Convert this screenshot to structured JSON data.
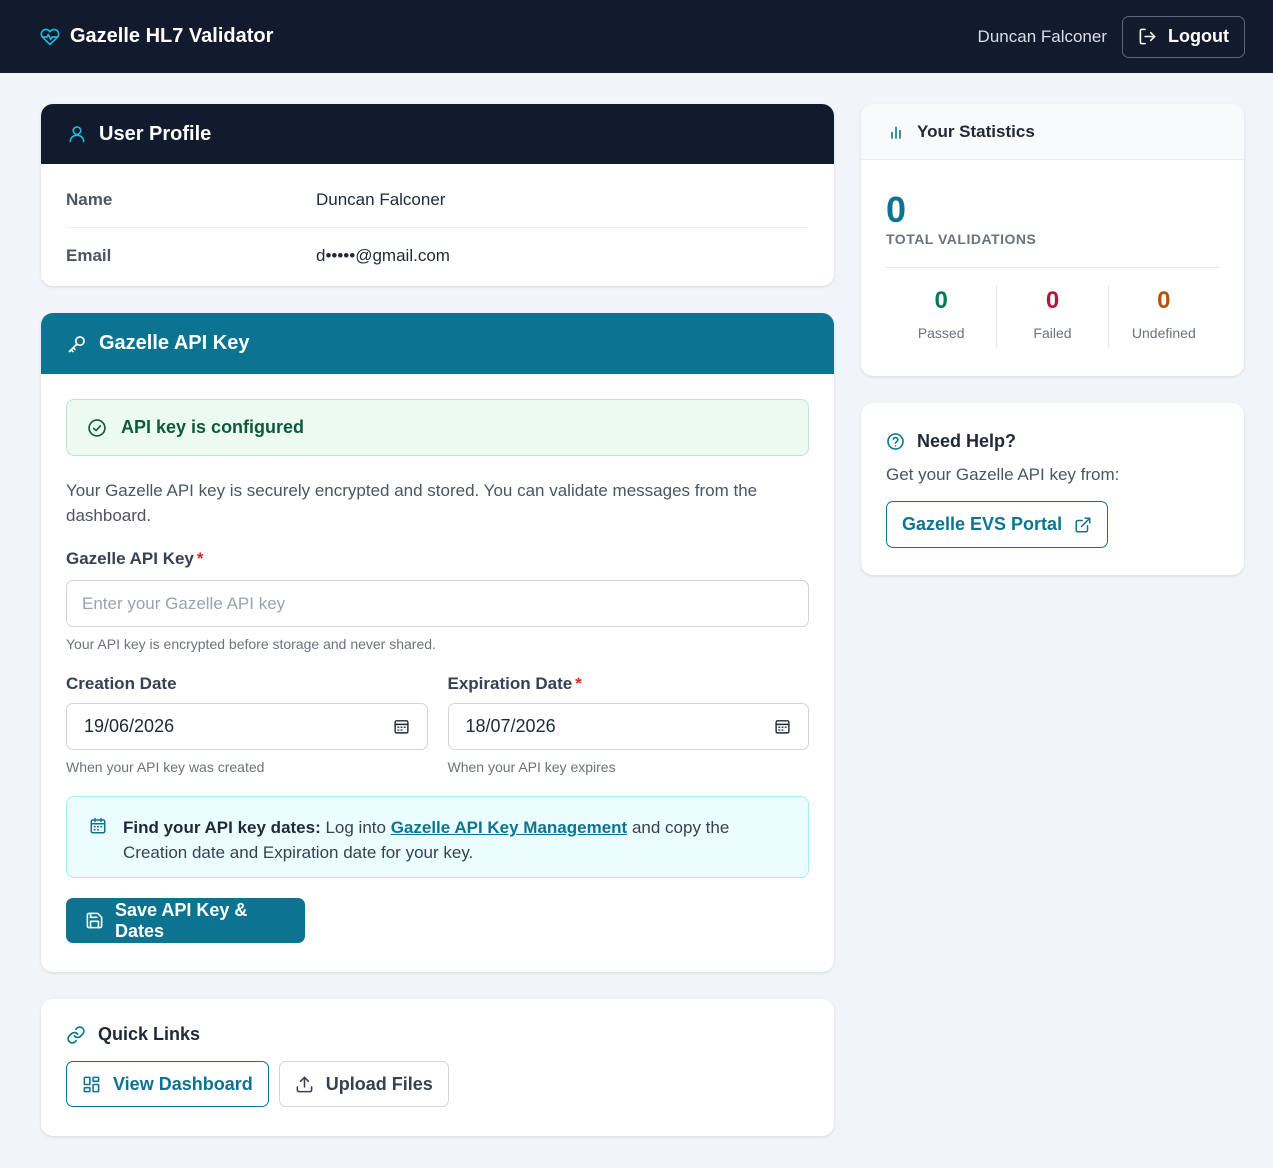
{
  "navbar": {
    "brand": "Gazelle HL7 Validator",
    "user_name": "Duncan Falconer",
    "logout_label": "Logout"
  },
  "profile": {
    "title": "User Profile",
    "rows": [
      {
        "label": "Name",
        "value": "Duncan Falconer"
      },
      {
        "label": "Email",
        "value": "d•••••@gmail.com"
      }
    ]
  },
  "api_key": {
    "title": "Gazelle API Key",
    "status_text": "API key is configured",
    "description": "Your Gazelle API key is securely encrypted and stored. You can validate messages from the dashboard.",
    "key_label": "Gazelle API Key",
    "required_mark": "*",
    "key_placeholder": "Enter your Gazelle API key",
    "key_value": "",
    "key_helper": "Your API key is encrypted before storage and never shared.",
    "creation_label": "Creation Date",
    "creation_value": "19/06/2026",
    "creation_helper": "When your API key was created",
    "expiration_label": "Expiration Date",
    "expiration_value": "18/07/2026",
    "expiration_helper": "When your API key expires",
    "info_bold": "Find your API key dates:",
    "info_pre_link": " Log into ",
    "info_link": "Gazelle API Key Management",
    "info_post_link": " and copy the Creation date and Expiration date for your key.",
    "save_label": "Save API Key & Dates"
  },
  "quick_links": {
    "title": "Quick Links",
    "dashboard_label": "View Dashboard",
    "upload_label": "Upload Files"
  },
  "stats": {
    "title": "Your Statistics",
    "total": "0",
    "total_label": "TOTAL VALIDATIONS",
    "items": [
      {
        "value": "0",
        "label": "Passed",
        "color": "#067a52"
      },
      {
        "value": "0",
        "label": "Failed",
        "color": "#be123c"
      },
      {
        "value": "0",
        "label": "Undefined",
        "color": "#b45309"
      }
    ]
  },
  "help": {
    "title": "Need Help?",
    "text": "Get your Gazelle API key from:",
    "button_label": "Gazelle EVS Portal"
  },
  "colors": {
    "navy": "#111b2d",
    "teal": "#0c7490",
    "page_bg": "#f1f4f8"
  }
}
